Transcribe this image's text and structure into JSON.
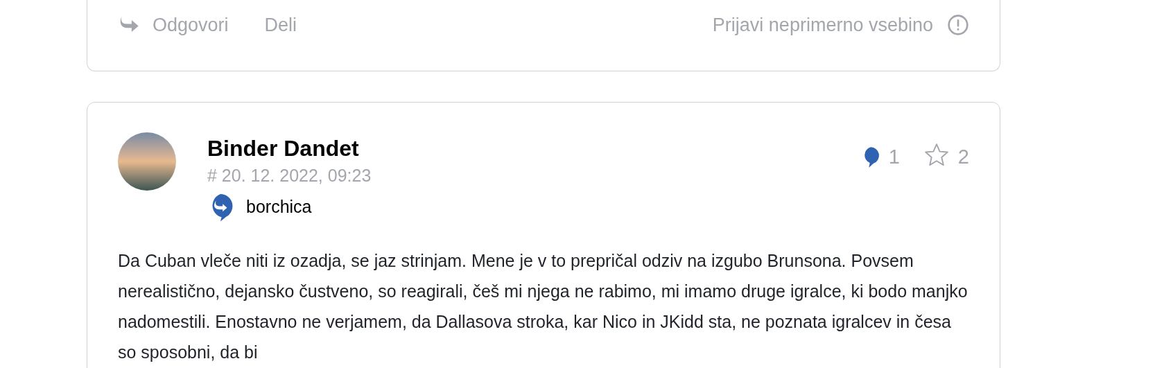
{
  "previous_post": {
    "actions": {
      "reply": "Odgovori",
      "share": "Deli",
      "report": "Prijavi neprimerno vsebino"
    }
  },
  "post": {
    "author": "Binder Dandet",
    "timestamp": "# 20. 12. 2022, 09:23",
    "reply_to": "borchica",
    "comment_count": "1",
    "favorite_count": "2",
    "body": "Da Cuban vleče niti iz ozadja, se jaz strinjam. Mene je v to prepričal odziv na izgubo Brunsona. Povsem nerealistično, dejansko čustveno, so reagirali, češ mi njega ne rabimo, mi imamo druge igralce, ki bodo manjko nadomestili. Enostavno ne verjamem, da Dallasova stroka, kar Nico in JKidd sta, ne poznata igralcev in česa so sposobni, da bi"
  }
}
